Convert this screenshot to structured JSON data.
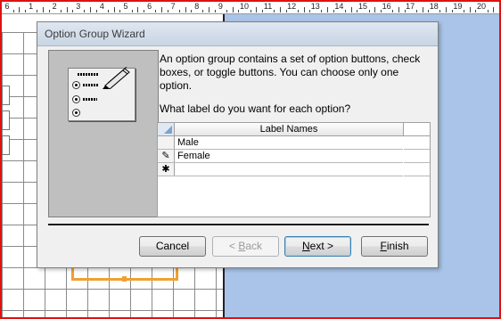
{
  "ruler": {
    "numbers": [
      "6",
      "1",
      "2",
      "3",
      "4",
      "5",
      "6",
      "7",
      "8",
      "9",
      "10",
      "11",
      "12",
      "13",
      "14",
      "15",
      "16",
      "17",
      "18",
      "19",
      "20"
    ]
  },
  "dialog": {
    "title": "Option Group Wizard",
    "description": "An option group contains a set of option buttons, check boxes, or toggle buttons. You can choose only one option.",
    "question": "What label do you want for each option?",
    "table": {
      "column_header": "Label Names",
      "rows": [
        {
          "selector": "",
          "value": "Male"
        },
        {
          "selector": "✎",
          "value": "Female"
        },
        {
          "selector": "✱",
          "value": ""
        }
      ]
    },
    "buttons": {
      "cancel": "Cancel",
      "back_prefix": "< ",
      "back_key": "B",
      "back_rest": "ack",
      "next_key": "N",
      "next_rest": "ext >",
      "finish_key": "F",
      "finish_rest": "inish"
    }
  },
  "colors": {
    "frame": "#e01010",
    "surface_right": "#a9c4e8",
    "control_outline": "#f0a030",
    "illustration_bg": "#bfbfbf"
  },
  "icons": [
    "pencil-icon",
    "radio-icon",
    "new-record-icon",
    "edit-record-icon"
  ]
}
